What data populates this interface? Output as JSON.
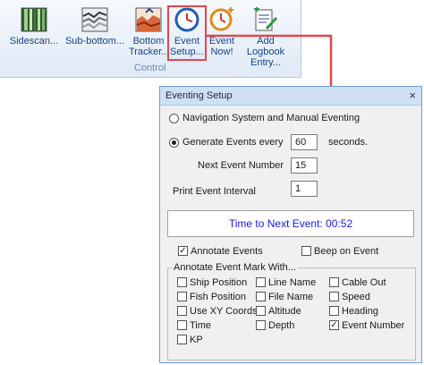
{
  "ribbon": {
    "buttons": [
      {
        "key": "sidescan",
        "label": "Sidescan..."
      },
      {
        "key": "subbottom",
        "label": "Sub-bottom..."
      },
      {
        "key": "bottom_tracker",
        "label": "Bottom Tracker..."
      },
      {
        "key": "event_setup",
        "label": "Event Setup..."
      },
      {
        "key": "event_now",
        "label": "Event Now!"
      },
      {
        "key": "add_logbook",
        "label": "Add Logbook Entry..."
      }
    ],
    "group_label": "Control"
  },
  "dialog": {
    "title": "Eventing Setup",
    "close_glyph": "×",
    "radio_nav_manual": "Navigation System and Manual Eventing",
    "radio_generate": "Generate Events every",
    "interval_value": "60",
    "seconds_label": "seconds.",
    "next_event_label": "Next Event Number",
    "next_event_value": "15",
    "print_interval_label": "Print Event Interval",
    "print_interval_value": "1",
    "timer_text": "Time to Next Event: 00:52",
    "annotate_events_label": "Annotate Events",
    "beep_on_event_label": "Beep on Event",
    "annotate_group_title": "Annotate Event Mark With...",
    "options": {
      "ship_position": "Ship Position",
      "line_name": "Line Name",
      "cable_out": "Cable Out",
      "fish_position": "Fish Position",
      "file_name": "File Name",
      "speed": "Speed",
      "use_xy_coords": "Use XY Coords",
      "altitude": "Altitude",
      "heading": "Heading",
      "time": "Time",
      "depth": "Depth",
      "event_number": "Event Number",
      "kp": "KP"
    },
    "checked": {
      "annotate_events": true,
      "beep_on_event": false,
      "event_number": true
    },
    "selected_radio": "generate"
  },
  "colors": {
    "highlight": "#e0474c",
    "timer_text": "#1a1ad6",
    "ribbon_label": "#15428b"
  }
}
